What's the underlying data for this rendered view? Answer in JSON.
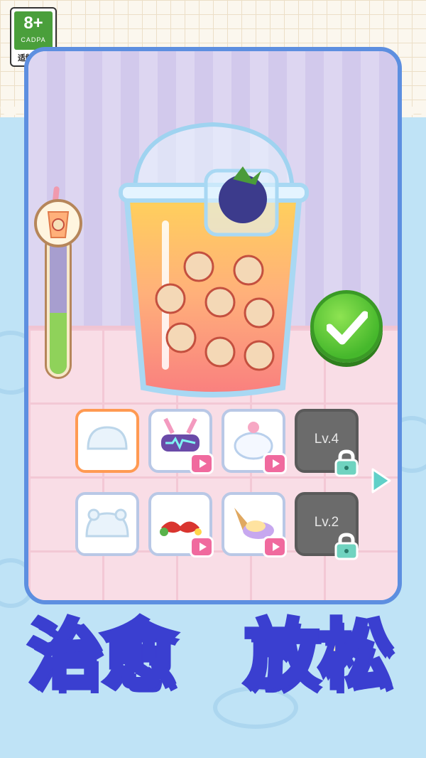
{
  "age_rating": {
    "number": "8+",
    "org": "CADPA",
    "tip": "适龄提示"
  },
  "progress": {
    "fill_fraction": 0.45
  },
  "ingredients": {
    "row1": [
      {
        "name": "pudding",
        "state": "selected"
      },
      {
        "name": "bunny-headset",
        "state": "ad-unlock"
      },
      {
        "name": "cat-cream",
        "state": "ad-unlock"
      },
      {
        "name": "locked",
        "state": "locked",
        "label": "Lv.4"
      }
    ],
    "row2": [
      {
        "name": "bear-pudding",
        "state": "normal"
      },
      {
        "name": "strawberry-bow",
        "state": "ad-unlock"
      },
      {
        "name": "ice-cream-cone",
        "state": "ad-unlock"
      },
      {
        "name": "locked",
        "state": "locked",
        "label": "Lv.2"
      }
    ]
  },
  "title": {
    "part1": "治愈",
    "part2": "放松"
  },
  "colors": {
    "card_border": "#5d8fe0",
    "confirm_green": "#46b82c",
    "title_fill": "#fff8b0",
    "title_stroke": "#3a3fd0",
    "selected_border": "#ff9a52"
  }
}
